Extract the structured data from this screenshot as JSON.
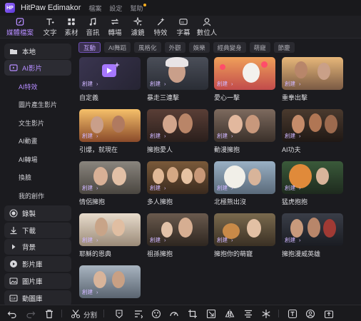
{
  "app": {
    "logo_text": "HP",
    "title": "HitPaw Edimakor",
    "menu": [
      "檔案",
      "設定",
      "幫助"
    ]
  },
  "toolbar": {
    "tools": [
      {
        "label": "媒體檔案",
        "icon": "media-icon",
        "active": true
      },
      {
        "label": "文字",
        "icon": "text-icon"
      },
      {
        "label": "素材",
        "icon": "sticker-icon"
      },
      {
        "label": "音訊",
        "icon": "music-icon"
      },
      {
        "label": "轉場",
        "icon": "transition-icon"
      },
      {
        "label": "濾鏡",
        "icon": "filter-icon"
      },
      {
        "label": "特效",
        "icon": "effect-icon"
      },
      {
        "label": "字幕",
        "icon": "subtitle-icon"
      },
      {
        "label": "數位人",
        "icon": "avatar-icon"
      }
    ]
  },
  "sidebar": {
    "groups": [
      {
        "label": "本地",
        "icon": "folder-icon"
      },
      {
        "label": "AI影片",
        "icon": "ai-video-icon",
        "active": true
      },
      {
        "label": "錄製",
        "icon": "record-icon"
      },
      {
        "label": "下載",
        "icon": "download-icon"
      },
      {
        "label": "背景",
        "icon": "play-triangle-icon"
      },
      {
        "label": "影片庫",
        "icon": "video-library-icon"
      },
      {
        "label": "圖片庫",
        "icon": "image-library-icon"
      },
      {
        "label": "動圖庫",
        "icon": "gif-library-icon"
      }
    ],
    "sub_items": [
      {
        "label": "AI特效",
        "active": true
      },
      {
        "label": "圖片產生影片"
      },
      {
        "label": "文生影片"
      },
      {
        "label": "AI動畫"
      },
      {
        "label": "AI轉場"
      },
      {
        "label": "換臉"
      },
      {
        "label": "我的創作"
      }
    ]
  },
  "filters": [
    "互動",
    "AI舞蹈",
    "風格化",
    "外觀",
    "娛樂",
    "經典變身",
    "萌寵",
    "節慶"
  ],
  "active_filter": "互動",
  "card_badge": "創建",
  "card_badge_arrow": "›",
  "cards": [
    {
      "caption": "自定義",
      "thumb": "custom"
    },
    {
      "caption": "暴走三連擊"
    },
    {
      "caption": "愛心一擊"
    },
    {
      "caption": "重拳出擊"
    },
    {
      "caption": "引爆，就現在"
    },
    {
      "caption": "擁抱愛人"
    },
    {
      "caption": "動漫擁抱"
    },
    {
      "caption": "AI功夫"
    },
    {
      "caption": "情侶擁抱"
    },
    {
      "caption": "多人擁抱"
    },
    {
      "caption": "北極熊出沒"
    },
    {
      "caption": "猛虎抱抱"
    },
    {
      "caption": "耶穌的恩典"
    },
    {
      "caption": "祖孫擁抱"
    },
    {
      "caption": "擁抱你的萌寵"
    },
    {
      "caption": "擁抱漫威英雄"
    },
    {
      "caption": ""
    }
  ],
  "bottom": {
    "split_label": "分割"
  },
  "colors": {
    "accent": "#b58cff",
    "panel": "#1b1b1f",
    "chip_active_bg": "#3b3150"
  }
}
